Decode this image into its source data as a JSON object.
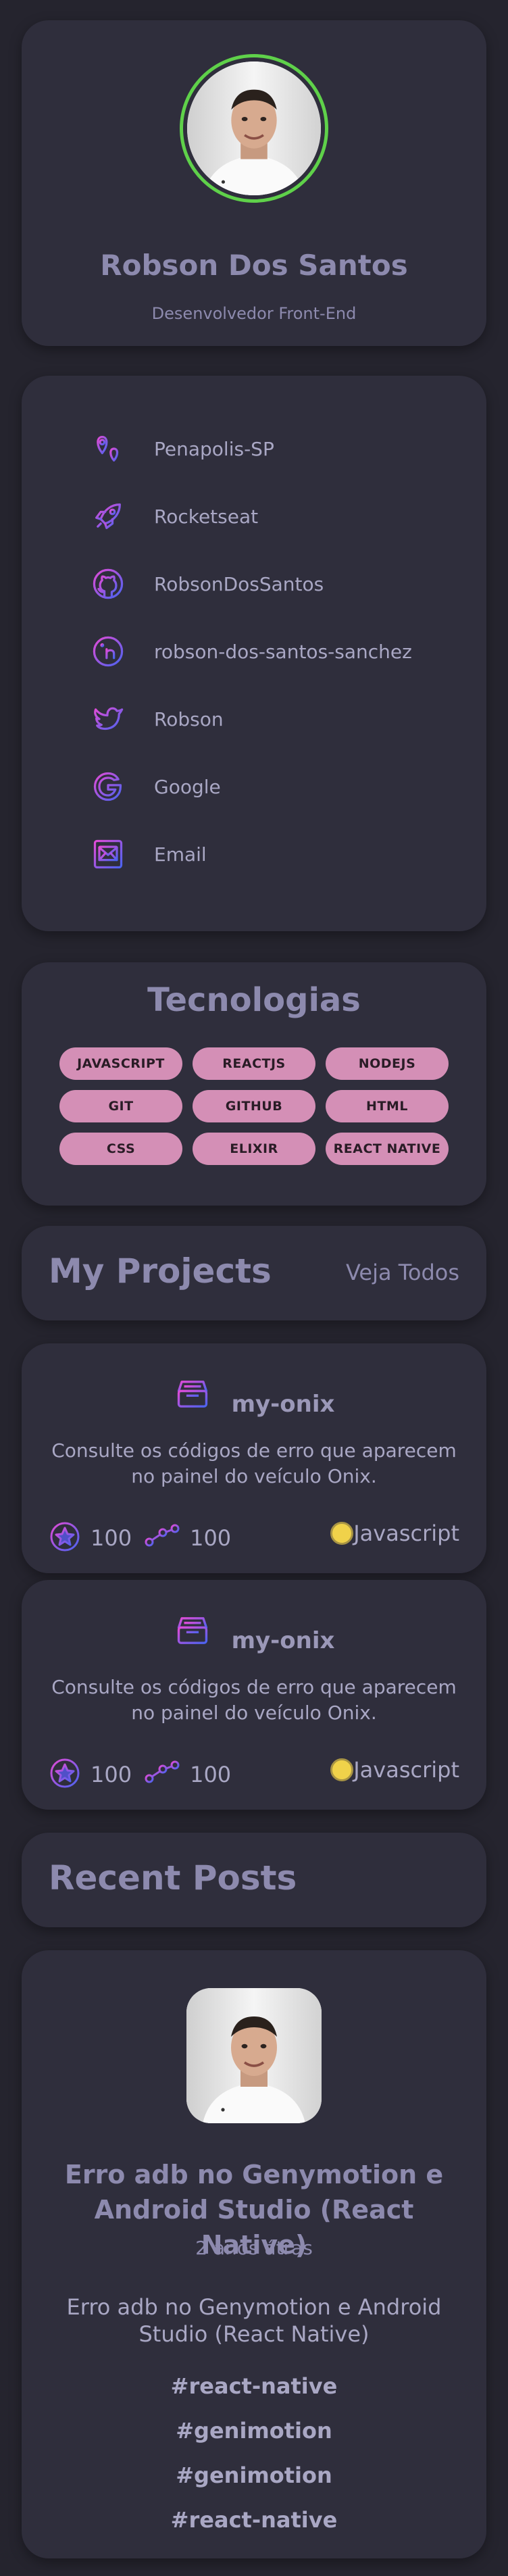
{
  "profile": {
    "name": "Robson Dos Santos",
    "role": "Desenvolvedor Front-End"
  },
  "links": [
    {
      "label": "Penapolis-SP",
      "icon": "map-pin-icon"
    },
    {
      "label": "Rocketseat",
      "icon": "rocket-icon"
    },
    {
      "label": "RobsonDosSantos",
      "icon": "github-icon"
    },
    {
      "label": "robson-dos-santos-sanchez",
      "icon": "linkedin-icon"
    },
    {
      "label": "Robson",
      "icon": "twitter-icon"
    },
    {
      "label": "Google",
      "icon": "google-icon"
    },
    {
      "label": "Email",
      "icon": "email-icon"
    }
  ],
  "tech": {
    "title": "Tecnologias",
    "badges": [
      "JAVASCRIPT",
      "REACTJS",
      "NODEJS",
      "GIT",
      "GITHUB",
      "HTML",
      "CSS",
      "ELIXIR",
      "REACT NATIVE"
    ]
  },
  "projects_header": {
    "title": "My Projects",
    "see_all": "Veja Todos"
  },
  "projects": [
    {
      "name": "my-onix",
      "description": "Consulte os códigos de erro que aparecem no painel do veículo Onix.",
      "stars": "100",
      "forks": "100",
      "language": "Javascript"
    },
    {
      "name": "my-onix",
      "description": "Consulte os códigos de erro que aparecem no painel do veículo Onix.",
      "stars": "100",
      "forks": "100",
      "language": "Javascript"
    }
  ],
  "posts_header": {
    "title": "Recent Posts"
  },
  "post": {
    "title": "Erro adb no Genymotion e Android Studio (React Native)",
    "date": "2 anos átras",
    "excerpt": "Erro adb no Genymotion e Android Studio (React Native)",
    "tags": [
      "#react-native",
      "#genimotion",
      "#genimotion",
      "#react-native"
    ]
  },
  "colors": {
    "background": "#25242e",
    "card": "#2f2e3c",
    "badge": "#d48fb6",
    "avatar_ring": "#5fd14a",
    "icon_gradient_start": "#e14bd6",
    "icon_gradient_end": "#4a63f0"
  }
}
